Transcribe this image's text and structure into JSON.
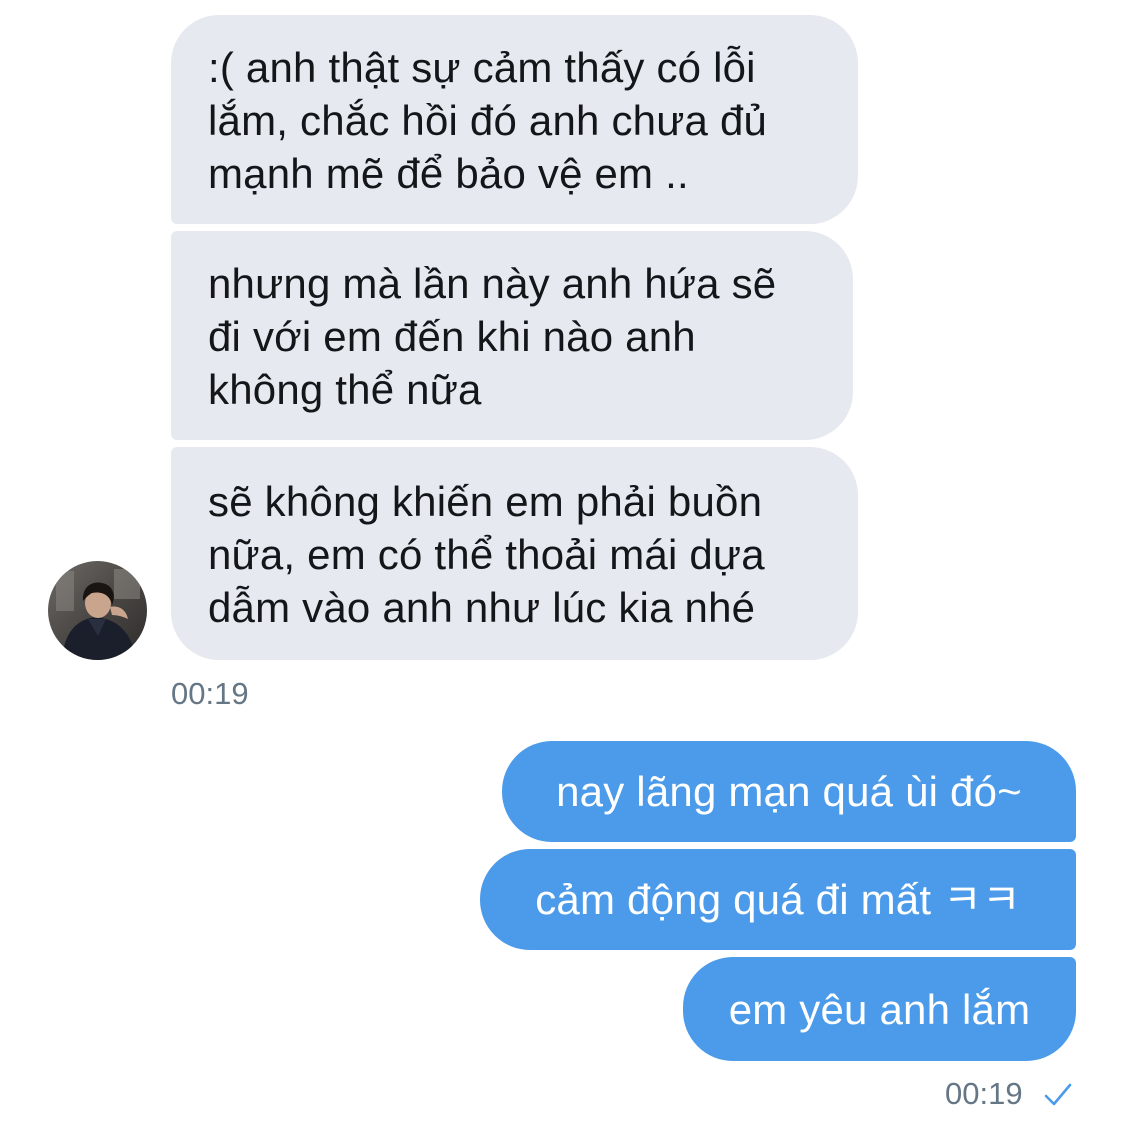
{
  "conversation": {
    "incoming": {
      "messages": [
        ":( anh thật sự cảm thấy có lỗi\nlắm, chắc hồi đó anh chưa đủ\nmạnh mẽ để bảo vệ em ..",
        "nhưng mà lần này anh hứa sẽ\nđi với em đến khi nào anh\nkhông thể nữa",
        "sẽ không khiến em phải buồn\nnữa, em có thể thoải mái dựa\ndẫm vào anh như lúc kia nhé"
      ],
      "timestamp": "00:19",
      "avatar_icon": "profile-photo"
    },
    "outgoing": {
      "messages": [
        "nay lãng mạn quá ùi đó~",
        "cảm động quá đi mất ㅋㅋ",
        "em yêu anh lắm"
      ],
      "timestamp": "00:19",
      "status_icon": "read-check-icon"
    }
  },
  "colors": {
    "incoming_bubble": "#e6e9ef",
    "outgoing_bubble": "#4c9bea",
    "timestamp": "#657786",
    "check": "#4c9bea"
  }
}
